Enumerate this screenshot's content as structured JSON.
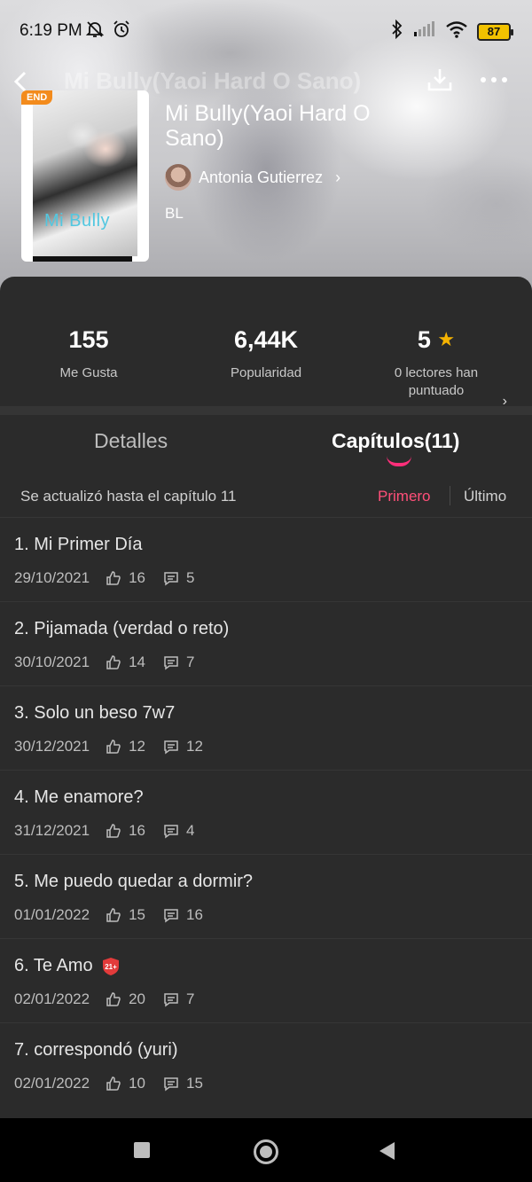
{
  "status_bar": {
    "time": "6:19 PM",
    "battery": "87"
  },
  "nav": {
    "ghost_title": "Mi Bully(Yaoi Hard O Sano)"
  },
  "book": {
    "end_badge": "END",
    "cover_text": "Mi Bully",
    "title": "Mi Bully(Yaoi Hard O Sano)",
    "author": "Antonia Gutierrez",
    "genre": "BL"
  },
  "stats": {
    "likes_value": "155",
    "likes_label": "Me Gusta",
    "popularity_value": "6,44K",
    "popularity_label": "Popularidad",
    "rating_value": "5",
    "rating_label": "0 lectores han puntuado"
  },
  "tabs": {
    "details": "Detalles",
    "chapters": "Capítulos(11)"
  },
  "update": {
    "text": "Se actualizó hasta el capítulo 11",
    "first": "Primero",
    "last": "Último"
  },
  "chapters": [
    {
      "title": "1. Mi Primer Día",
      "date": "29/10/2021",
      "likes": "16",
      "comments": "5",
      "badge": ""
    },
    {
      "title": "2. Pijamada (verdad o reto)",
      "date": "30/10/2021",
      "likes": "14",
      "comments": "7",
      "badge": ""
    },
    {
      "title": "3. Solo un beso 7w7",
      "date": "30/12/2021",
      "likes": "12",
      "comments": "12",
      "badge": ""
    },
    {
      "title": "4. Me enamore?",
      "date": "31/12/2021",
      "likes": "16",
      "comments": "4",
      "badge": ""
    },
    {
      "title": "5. Me puedo quedar a dormir?",
      "date": "01/01/2022",
      "likes": "15",
      "comments": "16",
      "badge": ""
    },
    {
      "title": "6. Te Amo",
      "date": "02/01/2022",
      "likes": "20",
      "comments": "7",
      "badge": "21+"
    },
    {
      "title": "7. correspondó (yuri)",
      "date": "02/01/2022",
      "likes": "10",
      "comments": "15",
      "badge": ""
    }
  ],
  "colors": {
    "accent_pink": "#ff4f79",
    "star": "#f5b301",
    "end_badge": "#f38b1c",
    "battery": "#f2c200"
  }
}
